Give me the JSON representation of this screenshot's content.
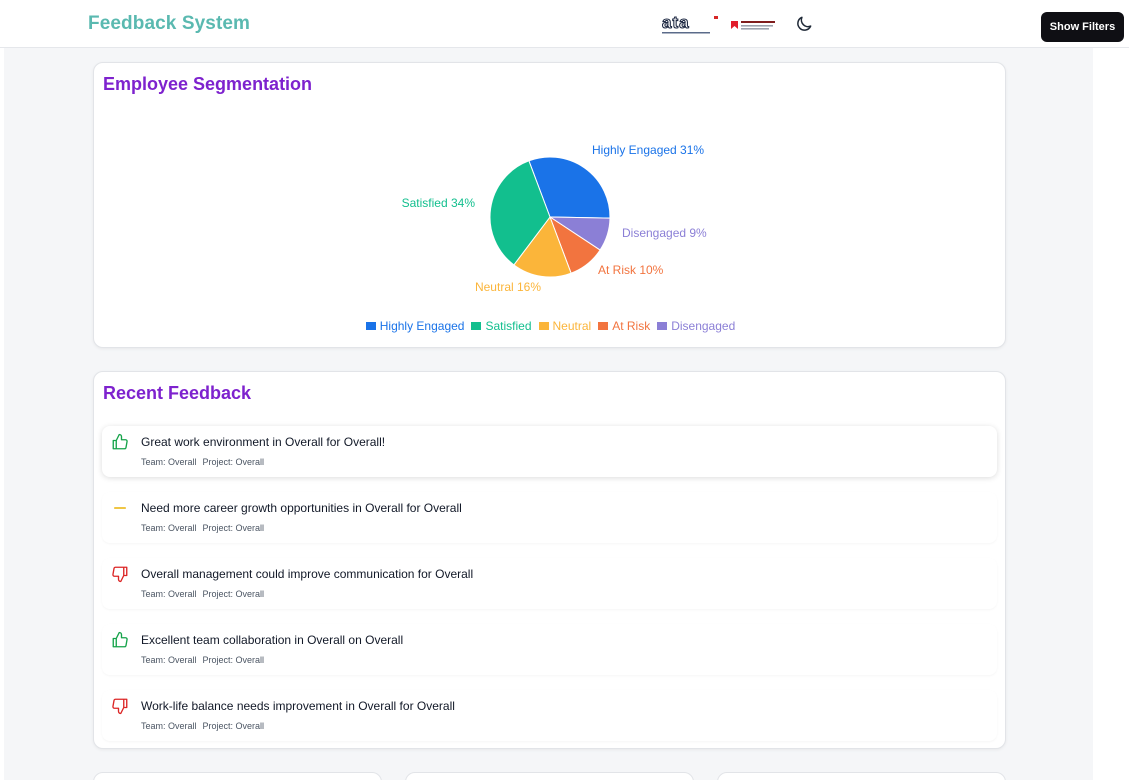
{
  "header": {
    "brand": "Feedback System",
    "logo_ata_text": "ata",
    "logo_nbc_text": "NATIONAL BANK",
    "theme_icon": "moon-icon",
    "filters_button": "Show Filters"
  },
  "segmentation": {
    "title": "Employee Segmentation",
    "chart_data": {
      "type": "pie",
      "title": "Employee Segmentation",
      "slices": [
        {
          "name": "Highly Engaged",
          "value": 31,
          "color": "#1a73e8",
          "label": "Highly Engaged 31%"
        },
        {
          "name": "Disengaged",
          "value": 9,
          "color": "#8b7fd6",
          "label": "Disengaged 9%"
        },
        {
          "name": "At Risk",
          "value": 10,
          "color": "#f2743f",
          "label": "At Risk 10%"
        },
        {
          "name": "Neutral",
          "value": 16,
          "color": "#fbb53a",
          "label": "Neutral 16%"
        },
        {
          "name": "Satisfied",
          "value": 34,
          "color": "#12bf8e",
          "label": "Satisfied 34%"
        }
      ],
      "legend": [
        "Highly Engaged",
        "Satisfied",
        "Neutral",
        "At Risk",
        "Disengaged"
      ],
      "legend_position": "bottom"
    }
  },
  "recent_feedback": {
    "title": "Recent Feedback",
    "items": [
      {
        "text": "Great work environment in Overall for Overall!",
        "team": "Team: Overall",
        "project": "Project: Overall",
        "sentiment": "positive",
        "icon": "thumbs-up-icon",
        "color": "#16a34a"
      },
      {
        "text": "Need more career growth opportunities in Overall for Overall",
        "team": "Team: Overall",
        "project": "Project: Overall",
        "sentiment": "neutral",
        "icon": "minus-icon",
        "color": "#eab308"
      },
      {
        "text": "Overall management could improve communication for Overall",
        "team": "Team: Overall",
        "project": "Project: Overall",
        "sentiment": "negative",
        "icon": "thumbs-down-icon",
        "color": "#dc2626"
      },
      {
        "text": "Excellent team collaboration in Overall on Overall",
        "team": "Team: Overall",
        "project": "Project: Overall",
        "sentiment": "positive",
        "icon": "thumbs-up-icon",
        "color": "#16a34a"
      },
      {
        "text": "Work-life balance needs improvement in Overall for Overall",
        "team": "Team: Overall",
        "project": "Project: Overall",
        "sentiment": "negative",
        "icon": "thumbs-down-icon",
        "color": "#dc2626"
      }
    ]
  }
}
